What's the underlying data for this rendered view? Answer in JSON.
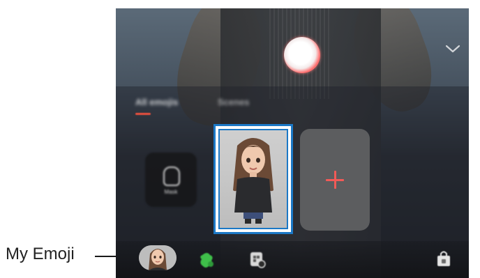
{
  "screen": {
    "tabs": [
      {
        "label": "All emojis",
        "active": true
      },
      {
        "label": "Scenes",
        "active": false
      }
    ],
    "mask_tile_label": "Mask",
    "add_tile_label": "+",
    "accent_color": "#f25a57",
    "highlight_color": "#1b78c6",
    "bottom_bar_icons": [
      "my-emoji-icon",
      "ar-doodle-icon",
      "sticker-icon",
      "shop-icon"
    ]
  },
  "callout": {
    "label": "My Emoji"
  }
}
